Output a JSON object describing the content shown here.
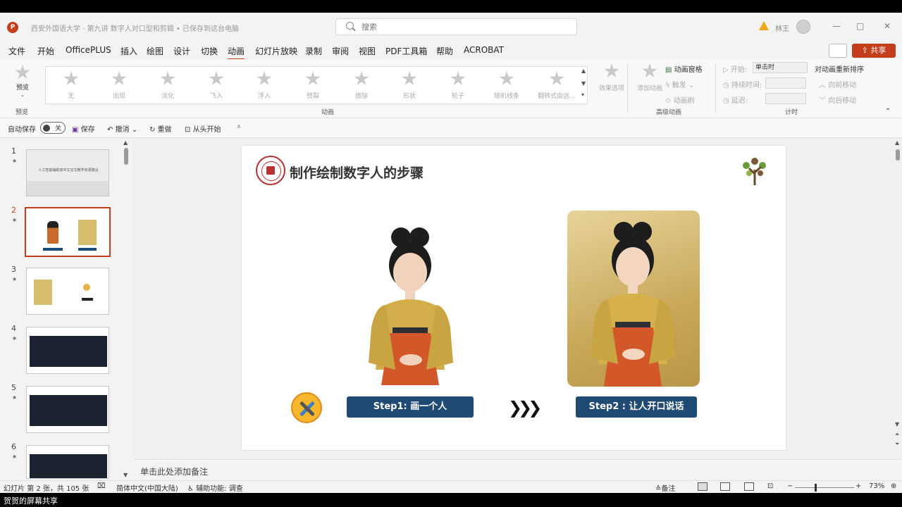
{
  "app": {
    "title": "西安外国语大学 · 第九讲 数字人对口型和剪辑 • 已保存到这台电脑",
    "search_placeholder": "搜索",
    "user": "林王",
    "logo": "P"
  },
  "window_controls": [
    "—",
    "□",
    "✕"
  ],
  "menu": [
    "文件",
    "开始",
    "OfficePLUS",
    "插入",
    "绘图",
    "设计",
    "切换",
    "动画",
    "幻灯片放映",
    "录制",
    "审阅",
    "视图",
    "PDF工具箱",
    "帮助",
    "ACROBAT"
  ],
  "active_menu": "动画",
  "share_label": "共享",
  "ribbon": {
    "preview_label": "预览",
    "preview_group": "预览",
    "animation_group": "动画",
    "animations": [
      "无",
      "出现",
      "淡化",
      "飞入",
      "浮入",
      "劈裂",
      "擦除",
      "形状",
      "轮子",
      "随机线条",
      "翻转式由远..."
    ],
    "effect_options": "效果选项",
    "add_animation": "添加动画",
    "animation_pane": "动画窗格",
    "trigger": "触发",
    "animation_painter": "动画刷",
    "advanced_group": "高级动画",
    "start_label": "开始:",
    "start_value": "单击时",
    "duration_label": "持续时间:",
    "delay_label": "延迟:",
    "timing_group": "计时",
    "reorder_label": "对动画重新排序",
    "move_earlier": "向前移动",
    "move_later": "向后移动"
  },
  "qat": {
    "autosave": "自动保存",
    "toggle_state": "关",
    "save": "保存",
    "undo": "撤消",
    "redo": "重做",
    "from_start": "从头开始"
  },
  "thumbnails": [
    {
      "num": "1",
      "title": "人工智能辅助高中文言文教学资源建设"
    },
    {
      "num": "2"
    },
    {
      "num": "3"
    },
    {
      "num": "4"
    },
    {
      "num": "5"
    },
    {
      "num": "6"
    }
  ],
  "slide": {
    "title": "制作绘制数字人的步骤",
    "step1": "Step1: 画一个人",
    "step2": "Step2 : 让人开口说话",
    "chevrons": "❯❯❯"
  },
  "notes_placeholder": "单击此处添加备注",
  "status": {
    "slide_count": "幻灯片 第 2 张，共 105 张",
    "language": "简体中文(中国大陆)",
    "accessibility": "辅助功能: 调查",
    "notes_btn": "备注",
    "zoom": "73%"
  },
  "share_banner": "贺贺的屏幕共享",
  "colors": {
    "accent": "#c43e1c",
    "step_button": "#1f4a73",
    "warning": "#f0a419"
  }
}
